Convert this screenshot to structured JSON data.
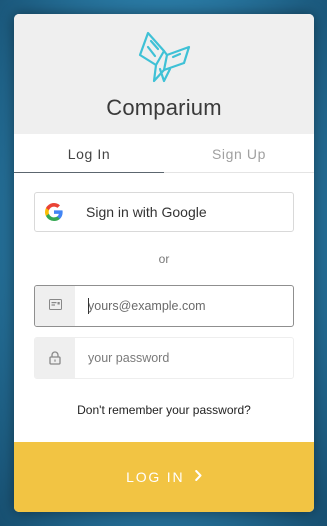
{
  "app": {
    "name": "Comparium",
    "logo_icon": "butterfly-logo-icon",
    "brand_color": "#3fc1d6"
  },
  "tabs": [
    {
      "label": "Log In",
      "active": true
    },
    {
      "label": "Sign Up",
      "active": false
    }
  ],
  "social": {
    "google_label": "Sign in with Google",
    "google_icon": "google-icon"
  },
  "divider": {
    "or_text": "or"
  },
  "form": {
    "email": {
      "value": "",
      "placeholder": "yours@example.com",
      "icon": "envelope-icon",
      "focused": true
    },
    "password": {
      "value": "",
      "placeholder": "your password",
      "icon": "lock-icon"
    }
  },
  "forgot_password": "Don't remember your password?",
  "submit": {
    "label": "LOG IN",
    "icon": "chevron-right-icon",
    "color": "#f2c443"
  }
}
